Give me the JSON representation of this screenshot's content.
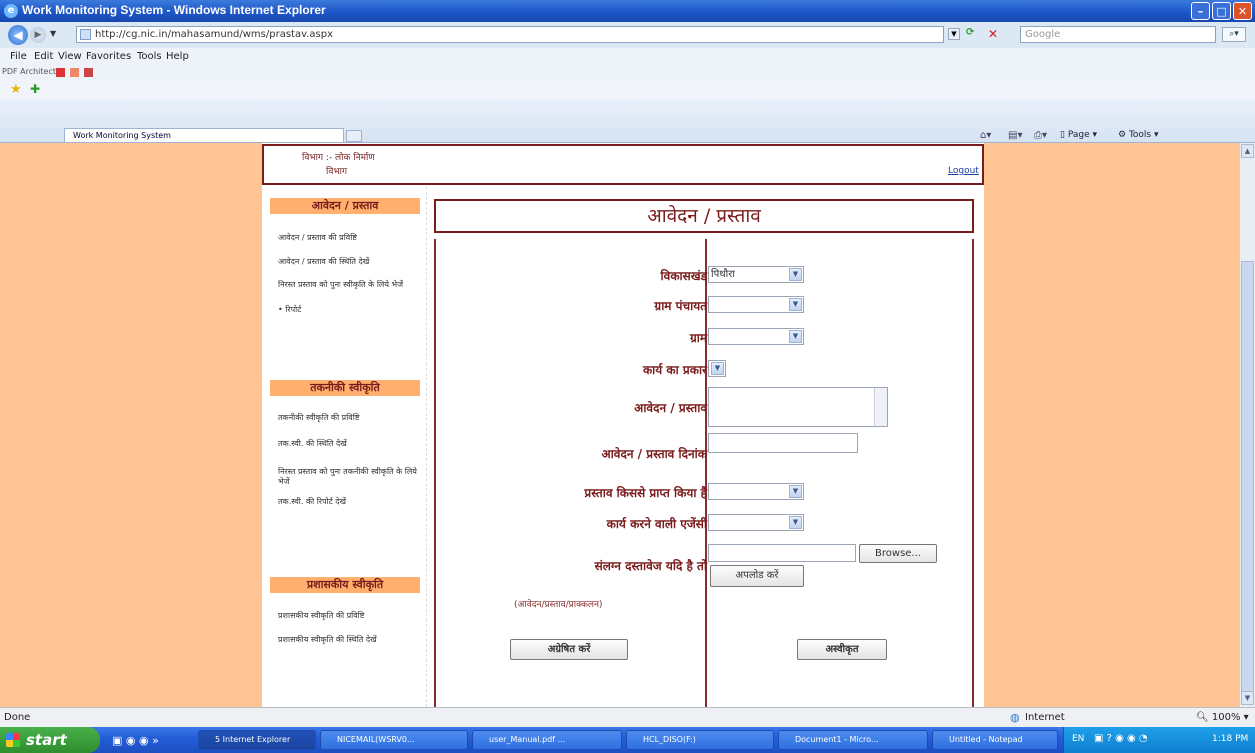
{
  "window": {
    "title": "Work Monitoring System - Windows Internet Explorer",
    "minimize": "–",
    "maximize": "□",
    "close": "✕"
  },
  "addressbar": {
    "url": "http://cg.nic.in/mahasamund/wms/prastav.aspx",
    "search_placeholder": "Google"
  },
  "menu": {
    "file": "File",
    "edit": "Edit",
    "view": "View",
    "favorites": "Favorites",
    "tools": "Tools",
    "help": "Help",
    "pdf_architect": "PDF Architect"
  },
  "tab": {
    "label": "Work Monitoring System"
  },
  "commandbar": {
    "page": "Page",
    "tools": "Tools"
  },
  "header": {
    "dept_line1": "विभाग :- लोक निर्माण",
    "dept_line2": "विभाग",
    "logout": "Logout"
  },
  "sidebar": {
    "sections": [
      {
        "title": "आवेदन / प्रस्ताव",
        "items": [
          "आवेदन / प्रस्ताव की प्रविष्टि",
          "आवेदन / प्रस्ताव की स्थिति देखें",
          "निरस्त प्रस्ताव को पुनः स्वीकृति के लिये भेजें",
          "रिपोर्ट"
        ]
      },
      {
        "title": "तकनीकी स्वीकृति",
        "items": [
          "तकनीकी स्वीकृति की प्रविष्टि",
          "तक.स्वी. की स्थिति देखें",
          "निरस्त प्रस्ताव को पुनः तकनीकी स्वीकृति के लिये भेजें",
          "तक.स्वी. की रिपोर्ट देखें"
        ]
      },
      {
        "title": "प्रशासकीय स्वीकृति",
        "items": [
          "प्रशासकीय स्वीकृति की प्रविष्टि",
          "प्रशासकीय स्वीकृति की स्थिति देखें"
        ]
      }
    ]
  },
  "form": {
    "title": "आवेदन / प्रस्ताव",
    "fields": {
      "block_label": "विकासखंड",
      "block_value": "पिथौरा",
      "gp_label": "ग्राम पंचायत",
      "gp_value": "",
      "village_label": "ग्राम",
      "village_value": "",
      "worktype_label": "कार्य का प्रकार",
      "proposal_label": "आवेदन / प्रस्ताव",
      "date_label": "आवेदन / प्रस्ताव दिनांक",
      "received_from_label": "प्रस्ताव किससे प्राप्त किया है",
      "agency_label": "कार्य करने वाली एजेंसी",
      "attach_label": "संलग्न दस्तावेज यदि है तो",
      "browse_button": "Browse...",
      "upload_button": "अपलोड करें",
      "attach_note": "(आवेदन/प्रस्ताव/प्राक्कलन)"
    },
    "buttons": {
      "submit": "अग्रेषित करें",
      "reject": "अस्वीकृत"
    }
  },
  "status": {
    "left": "Done",
    "zone": "Internet",
    "zoom": "100%"
  },
  "taskbar": {
    "start": "start",
    "tasks": [
      "5 Internet Explorer",
      "NICEMAIL(WSRV0...",
      "user_Manual.pdf ...",
      "HCL_DISO(F:)",
      "Document1 - Micro...",
      "Untitled - Notepad"
    ],
    "lang": "EN",
    "clock": "1:18 PM"
  },
  "colors": {
    "accent": "#7a1c1c",
    "nav_header": "#ffb06e",
    "page_bg": "#ffc594"
  }
}
